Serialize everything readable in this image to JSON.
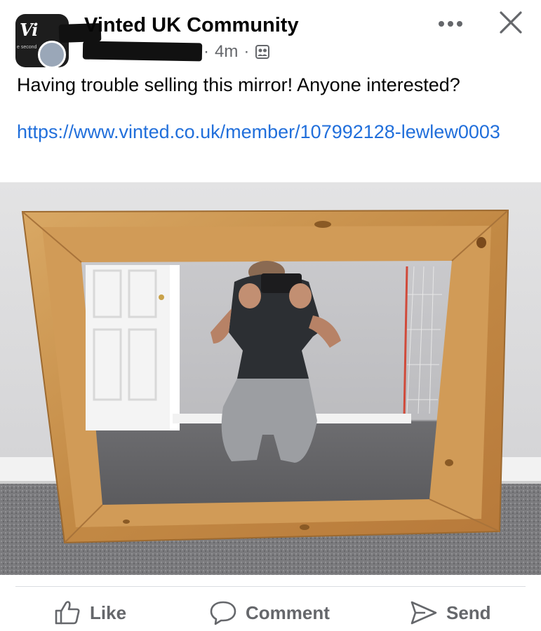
{
  "header": {
    "group_name": "Vinted UK Community",
    "time": "4m",
    "separator": "·",
    "privacy_icon": "members-icon",
    "avatar": {
      "logo_text": "Vi",
      "logo_sub": "e second"
    }
  },
  "post": {
    "text": "Having trouble selling this mirror! Anyone interested?",
    "link": "https://www.vinted.co.uk/member/107992128-lewlew0003"
  },
  "actions": {
    "like": "Like",
    "comment": "Comment",
    "send": "Send"
  },
  "colors": {
    "text": "#050505",
    "secondary": "#65676b",
    "link": "#216fdb",
    "frame": "#c8964f"
  }
}
